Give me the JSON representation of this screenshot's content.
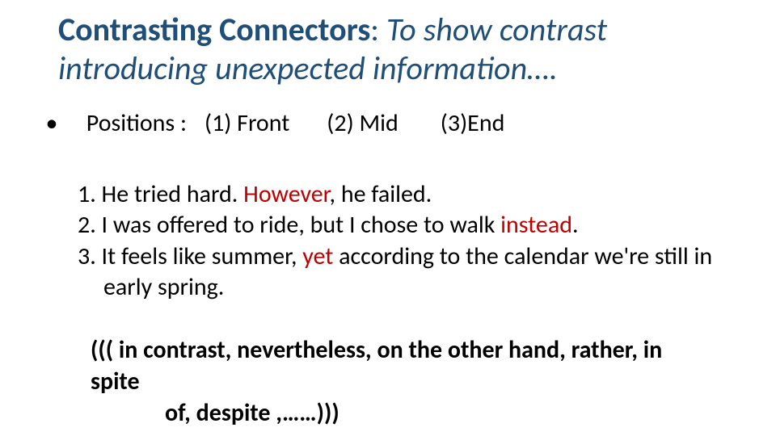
{
  "title": {
    "main": "Contrasting Connectors",
    "colon": ": ",
    "sub": "To show contrast"
  },
  "subtitle": "introducing unexpected information….",
  "positions": {
    "bullet": "•",
    "label": "Positions :",
    "p1": "(1) Front",
    "p2": "(2) Mid",
    "p3": "(3)End"
  },
  "examples": {
    "l1a": "1. He tried hard. ",
    "l1b": "However",
    "l1c": ", he failed.",
    "l2a": "2.  I was offered to ride, but I chose to walk ",
    "l2b": "instead",
    "l2c": ".",
    "l3a": "3. It feels like summer, ",
    "l3b": "yet ",
    "l3c": "according to the calendar we're still in",
    "l3d": "early spring."
  },
  "synonyms": {
    "line1": "((( in contrast, nevertheless, on the other hand, rather, in spite",
    "line2": "of, despite ,……)))"
  }
}
